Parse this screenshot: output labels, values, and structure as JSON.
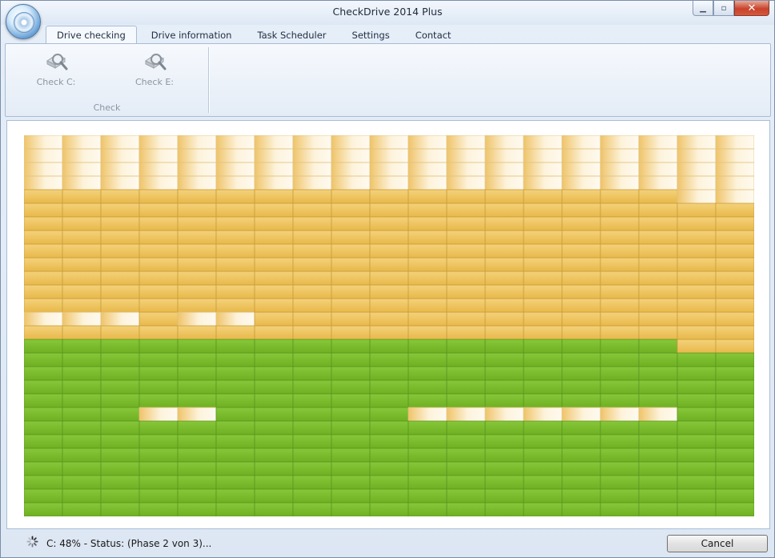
{
  "window": {
    "title": "CheckDrive 2014 Plus",
    "minimize_glyph": "▁",
    "maximize_glyph": "▫",
    "close_glyph": "✕"
  },
  "tabs": [
    {
      "label": "Drive checking",
      "active": true
    },
    {
      "label": "Drive information",
      "active": false
    },
    {
      "label": "Task Scheduler",
      "active": false
    },
    {
      "label": "Settings",
      "active": false
    },
    {
      "label": "Contact",
      "active": false
    }
  ],
  "ribbon": {
    "buttons": [
      {
        "label": "Check C:",
        "icon": "drive-search-icon",
        "enabled": false
      },
      {
        "label": "Check E:",
        "icon": "drive-search-icon",
        "enabled": false
      }
    ],
    "group_label": "Check"
  },
  "block_map": {
    "columns": 19,
    "rows": 28,
    "legend_note": "Each cell is a disk block. p=pending (light gradient), o=in progress/read (orange), g=checked OK (green)",
    "colors": {
      "pending_light": "#fdf3dc",
      "pending_dark": "#efc46a",
      "orange": "#eec25a",
      "orange_border": "#c99e3a",
      "green": "#7cbf2a",
      "green_border": "#5a9620"
    },
    "row_map": [
      "ppppppppppppppppppp",
      "ppppppppppppppppppp",
      "ppppppppppppppppppp",
      "ppppppppppppppppppp",
      "oooooooooooooooooPP",
      "ooooooooooooooooooo",
      "ooooooooooooooooooo",
      "ooooooooooooooooooo",
      "ooooooooooooooooooo",
      "ooooooooooooooooooo",
      "ooooooooooooooooooo",
      "ooooooooooooooooooo",
      "ooooooooooooooooooo",
      "pppoppooooooooooooo",
      "ooooooooooooooooooo",
      "gggggggggggggggggoo",
      "ggggggggggggggggggg",
      "ggggggggggggggggggg",
      "ggggggggggggggggggg",
      "ggggggggggggggggggg",
      "gggppgggggpppppppgg",
      "ggggggggggggggggggg",
      "ggggggggggggggggggg",
      "ggggggggggggggggggg",
      "ggggggggggggggggggg",
      "ggggggggggggggggggg",
      "ggggggggggggggggggg",
      "ggggggggggggggggggg"
    ]
  },
  "status": {
    "text": "C: 48% - Status: (Phase 2 von 3)...",
    "progress_percent": 48
  },
  "cancel_label": "Cancel"
}
